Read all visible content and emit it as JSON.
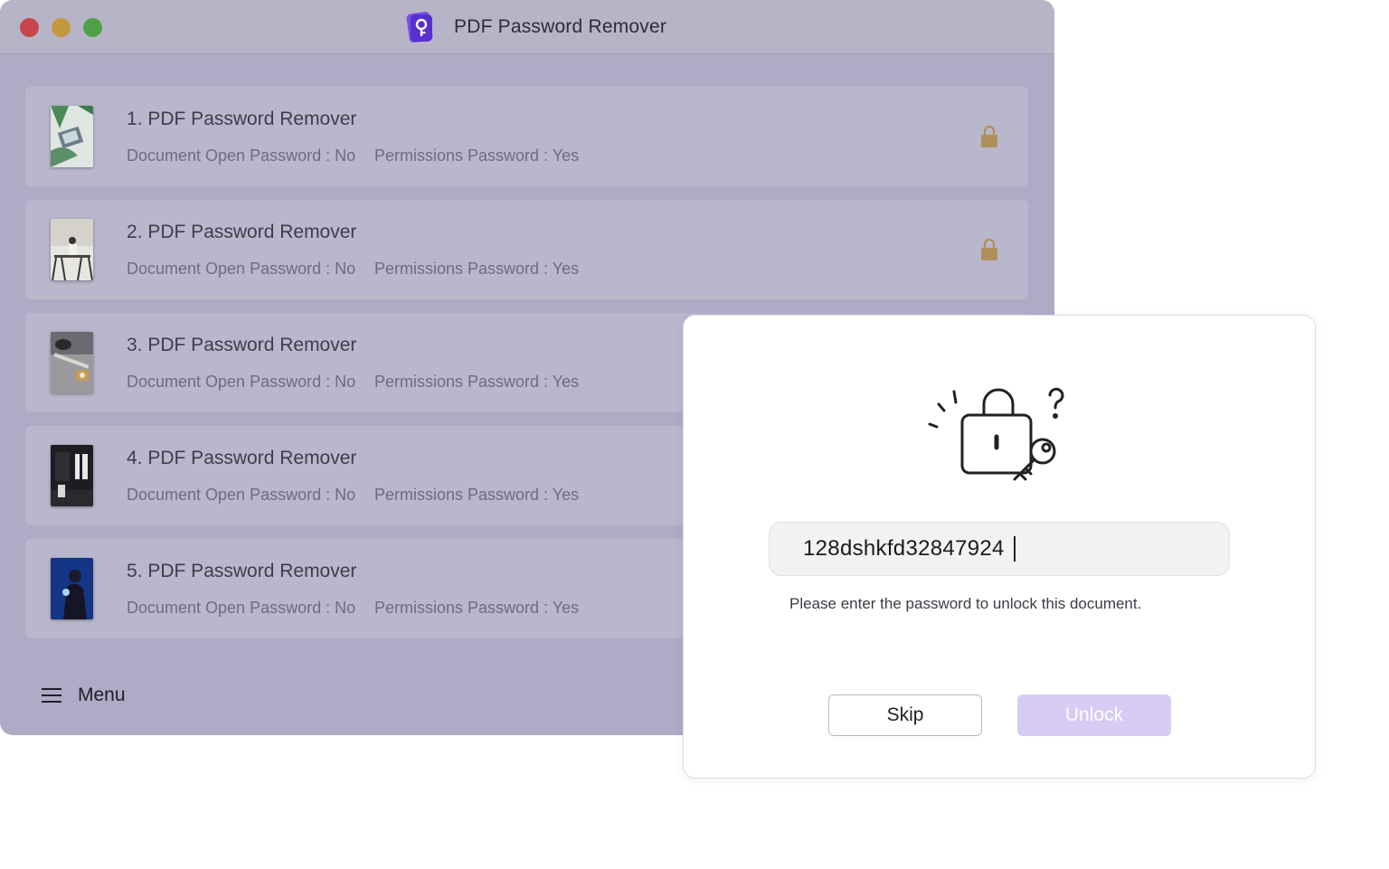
{
  "window": {
    "title": "PDF Password Remover"
  },
  "files": [
    {
      "name": "1. PDF Password Remover",
      "open_password": "Document Open Password : No",
      "permissions_password": "Permissions Password : Yes",
      "locked": true
    },
    {
      "name": "2. PDF Password Remover",
      "open_password": "Document Open Password : No",
      "permissions_password": "Permissions Password : Yes",
      "locked": true
    },
    {
      "name": "3. PDF Password Remover",
      "open_password": "Document Open Password : No",
      "permissions_password": "Permissions Password : Yes",
      "locked": false
    },
    {
      "name": "4. PDF Password Remover",
      "open_password": "Document Open Password : No",
      "permissions_password": "Permissions Password : Yes",
      "locked": false
    },
    {
      "name": "5. PDF Password Remover",
      "open_password": "Document Open Password : No",
      "permissions_password": "Permissions Password : Yes",
      "locked": false
    }
  ],
  "menu": {
    "label": "Menu",
    "icon": "hamburger-icon"
  },
  "dialog": {
    "illustration": "lock-key-question-icon",
    "password_value": "128dshkfd32847924",
    "hint": "Please enter the password to unlock this document.",
    "skip_label": "Skip",
    "unlock_label": "Unlock"
  },
  "colors": {
    "accent": "#6a3ce0",
    "unlock_disabled": "#d7ccf3",
    "lock_icon": "#b0905a"
  }
}
